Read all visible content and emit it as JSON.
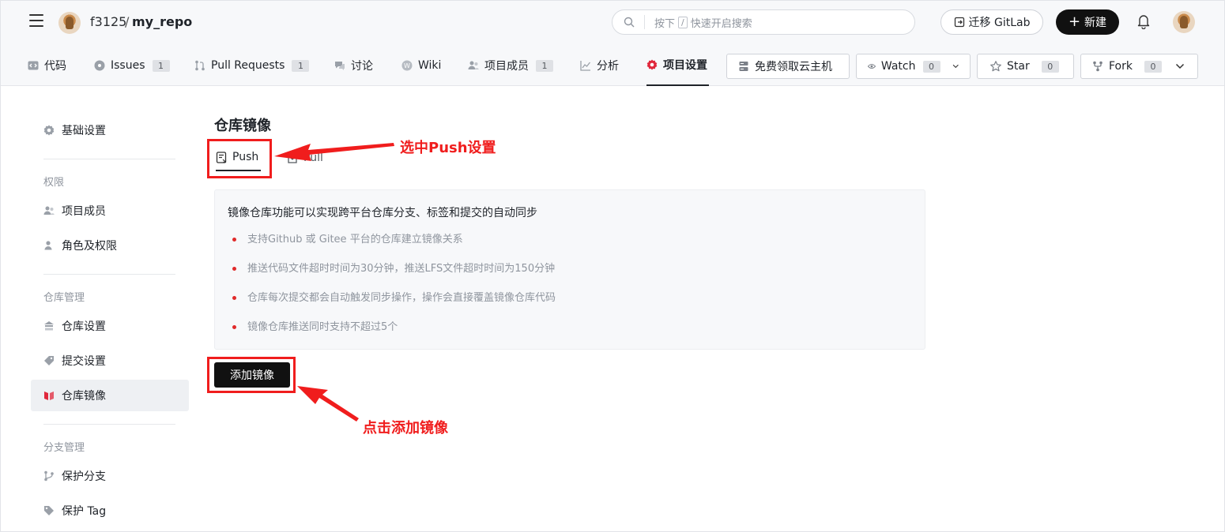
{
  "header": {
    "repo_owner": "f3125",
    "repo_separator": "/",
    "repo_name": "my_repo",
    "search": {
      "hint_prefix": "按下",
      "hint_key": "/",
      "hint_suffix": "快速开启搜索"
    },
    "migrate_button": "迁移 GitLab",
    "new_button": "新建"
  },
  "nav": {
    "tabs": [
      {
        "label": "代码",
        "icon": "code-icon"
      },
      {
        "label": "Issues",
        "badge": "1",
        "icon": "issues-icon"
      },
      {
        "label": "Pull Requests",
        "badge": "1",
        "icon": "pull-request-icon"
      },
      {
        "label": "讨论",
        "icon": "discussion-icon"
      },
      {
        "label": "Wiki",
        "icon": "wiki-icon"
      },
      {
        "label": "项目成员",
        "badge": "1",
        "icon": "members-icon"
      },
      {
        "label": "分析",
        "icon": "analytics-icon"
      },
      {
        "label": "项目设置",
        "icon": "settings-icon",
        "active": true
      }
    ],
    "free_host_button": "免费领取云主机",
    "watch": {
      "label": "Watch",
      "count": "0"
    },
    "star": {
      "label": "Star",
      "count": "0"
    },
    "fork": {
      "label": "Fork",
      "count": "0"
    }
  },
  "sidebar": {
    "basic": "基础设置",
    "group_permissions": "权限",
    "members": "项目成员",
    "roles": "角色及权限",
    "group_repo": "仓库管理",
    "repo_settings": "仓库设置",
    "commit_settings": "提交设置",
    "repo_mirror": "仓库镜像",
    "group_branch": "分支管理",
    "protect_branch": "保护分支",
    "protect_tag": "保护 Tag"
  },
  "main": {
    "title": "仓库镜像",
    "tab_push": "Push",
    "tab_pull": "Pull",
    "info_title": "镜像仓库功能可以实现跨平台仓库分支、标签和提交的自动同步",
    "info_items": [
      "支持Github 或 Gitee 平台的仓库建立镜像关系",
      "推送代码文件超时时间为30分钟，推送LFS文件超时时间为150分钟",
      "仓库每次提交都会自动触发同步操作，操作会直接覆盖镜像仓库代码",
      "镜像仓库推送同时支持不超过5个"
    ],
    "add_button": "添加镜像"
  },
  "annotations": {
    "push_note": "选中Push设置",
    "add_note": "点击添加镜像",
    "color": "#f01d1d"
  },
  "colors": {
    "accent_dark": "#111111",
    "settings_icon": "#e0283c",
    "bullet": "#e02a2a"
  }
}
